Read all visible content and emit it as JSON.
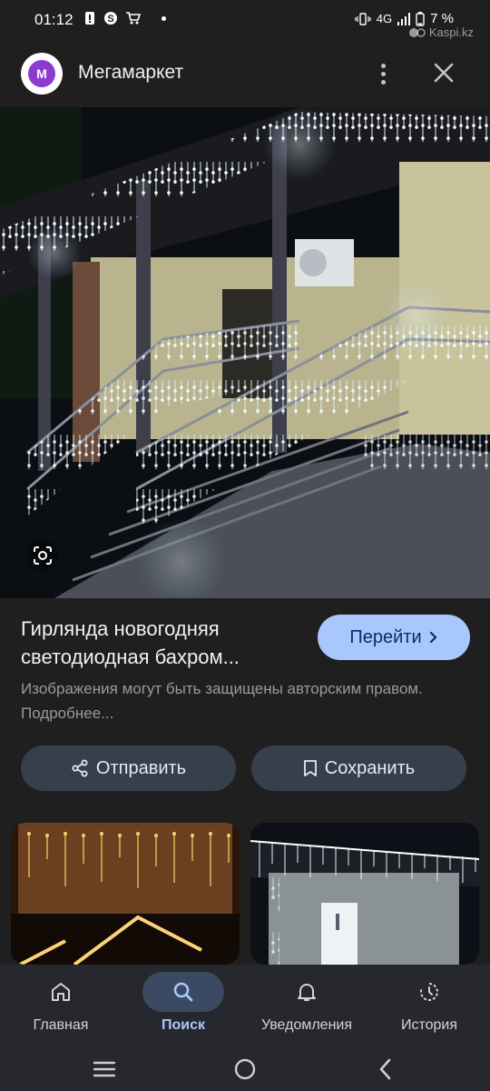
{
  "status": {
    "time": "01:12",
    "network": "4G",
    "battery": "7 %",
    "watermark": "Kaspi.kz"
  },
  "header": {
    "avatar_letter": "M",
    "avatar_color": "#8b3ccf",
    "title": "Мегамаркет"
  },
  "result": {
    "title": "Гирлянда новогодняя светодиодная бахром...",
    "go_label": "Перейти",
    "copyright": "Изображения могут быть защищены авторским правом. Подробнее..."
  },
  "actions": {
    "share_label": "Отправить",
    "save_label": "Сохранить"
  },
  "bottom_nav": {
    "items": [
      {
        "label": "Главная",
        "icon": "home-icon"
      },
      {
        "label": "Поиск",
        "icon": "search-icon",
        "active": true
      },
      {
        "label": "Уведомления",
        "icon": "bell-icon"
      },
      {
        "label": "История",
        "icon": "history-icon"
      }
    ]
  },
  "colors": {
    "accent": "#a8c7fa",
    "background": "#1f1f1f",
    "button_bg": "#36404d"
  }
}
